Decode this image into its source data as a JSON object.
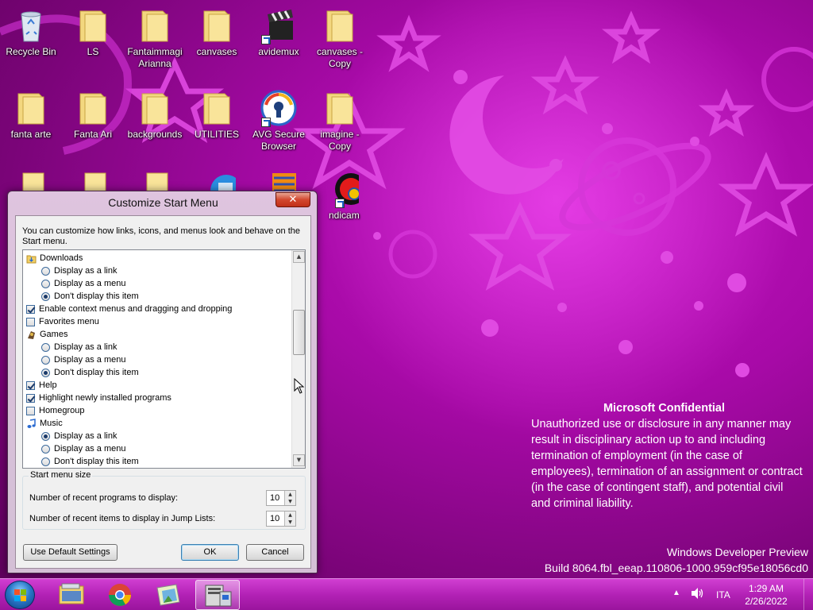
{
  "desktop": {
    "icons": [
      {
        "label": "Recycle Bin",
        "icon": "recycle-bin-icon"
      },
      {
        "label": "LS",
        "icon": "folder-icon"
      },
      {
        "label": "Fantaimmagi Arianna",
        "icon": "folder-icon"
      },
      {
        "label": "canvases",
        "icon": "folder-icon"
      },
      {
        "label": "avidemux",
        "icon": "clapperboard-icon"
      },
      {
        "label": "canvases - Copy",
        "icon": "folder-icon"
      },
      {
        "label": "fanta arte",
        "icon": "folder-icon"
      },
      {
        "label": "Fanta Ari",
        "icon": "folder-icon"
      },
      {
        "label": "backgrounds",
        "icon": "folder-icon"
      },
      {
        "label": "UTILITIES",
        "icon": "folder-icon"
      },
      {
        "label": "AVG Secure Browser",
        "icon": "avg-browser-icon"
      },
      {
        "label": "imagine - Copy",
        "icon": "folder-icon"
      },
      {
        "label": "ndicam",
        "icon": "bandicam-icon"
      }
    ]
  },
  "wallpaper": {
    "confidential_title": "Microsoft Confidential",
    "confidential_text": "Unauthorized use or disclosure in any manner may result in disciplinary action up to and including termination of employment (in the case of employees), termination of an assignment or contract (in the case of contingent staff), and potential civil and criminal liability.",
    "build_line1": "Windows Developer Preview",
    "build_line2": "Build 8064.fbl_eeap.110806-1000.959cf95e18056cd0"
  },
  "dialog": {
    "title": "Customize Start Menu",
    "close_label": "✕",
    "description": "You can customize how links, icons, and menus look and behave on the Start menu.",
    "items": [
      {
        "type": "header",
        "label": "Downloads",
        "icon": "downloads-folder-icon"
      },
      {
        "type": "radio",
        "label": "Display as a link",
        "checked": false
      },
      {
        "type": "radio",
        "label": "Display as a menu",
        "checked": false
      },
      {
        "type": "radio",
        "label": "Don't display this item",
        "checked": true
      },
      {
        "type": "check",
        "label": "Enable context menus and dragging and dropping",
        "checked": true
      },
      {
        "type": "check",
        "label": "Favorites menu",
        "checked": false
      },
      {
        "type": "header",
        "label": "Games",
        "icon": "games-icon"
      },
      {
        "type": "radio",
        "label": "Display as a link",
        "checked": false
      },
      {
        "type": "radio",
        "label": "Display as a menu",
        "checked": false
      },
      {
        "type": "radio",
        "label": "Don't display this item",
        "checked": true
      },
      {
        "type": "check",
        "label": "Help",
        "checked": true
      },
      {
        "type": "check",
        "label": "Highlight newly installed programs",
        "checked": true
      },
      {
        "type": "check",
        "label": "Homegroup",
        "checked": false
      },
      {
        "type": "header",
        "label": "Music",
        "icon": "music-note-icon"
      },
      {
        "type": "radio",
        "label": "Display as a link",
        "checked": true
      },
      {
        "type": "radio",
        "label": "Display as a menu",
        "checked": false
      },
      {
        "type": "radio",
        "label": "Don't display this item",
        "checked": false
      }
    ],
    "size_group_label": "Start menu size",
    "recent_programs_label": "Number of recent programs to display:",
    "recent_programs_value": "10",
    "recent_items_label": "Number of recent items to display in Jump Lists:",
    "recent_items_value": "10",
    "default_button": "Use Default Settings",
    "ok_button": "OK",
    "cancel_button": "Cancel"
  },
  "taskbar": {
    "pinned": [
      {
        "icon": "file-explorer-icon",
        "active": false
      },
      {
        "icon": "chrome-icon",
        "active": false
      },
      {
        "icon": "photo-viewer-icon",
        "active": false
      },
      {
        "icon": "control-panel-icon",
        "active": true
      }
    ],
    "tray_language": "ITA",
    "clock_time": "1:29 AM",
    "clock_date": "2/26/2022"
  },
  "colors": {
    "wallpaper_magenta": "#a80aa8",
    "taskbar": "#b322b6",
    "dialog_frame": "#dfc4df"
  }
}
